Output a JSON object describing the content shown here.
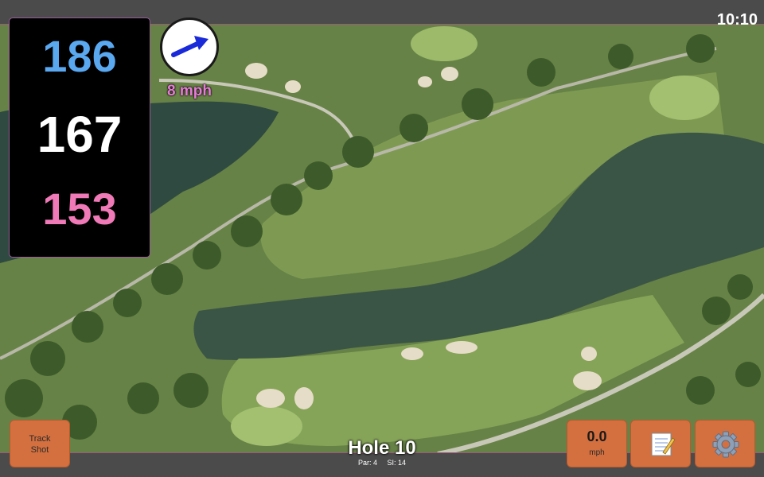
{
  "status_bar": {
    "time": "10:10"
  },
  "yardages": {
    "back": "186",
    "center": "167",
    "front": "153"
  },
  "wind": {
    "speed_label": "8 mph",
    "direction_icon": "arrow-icon"
  },
  "hole": {
    "title": "Hole 10",
    "par_label": "Par: 4",
    "si_label": "SI: 14"
  },
  "buttons": {
    "track_shot_line1": "Track",
    "track_shot_line2": "Shot",
    "speed_value": "0.0",
    "speed_unit": "mph",
    "notes_icon": "notepad-icon",
    "settings_icon": "gear-icon"
  },
  "colors": {
    "back_yardage": "#5aa8f0",
    "center_yardage": "#ffffff",
    "front_yardage": "#f07ab8",
    "wind_label": "#e87ad8",
    "button_bg": "#d4703f"
  }
}
